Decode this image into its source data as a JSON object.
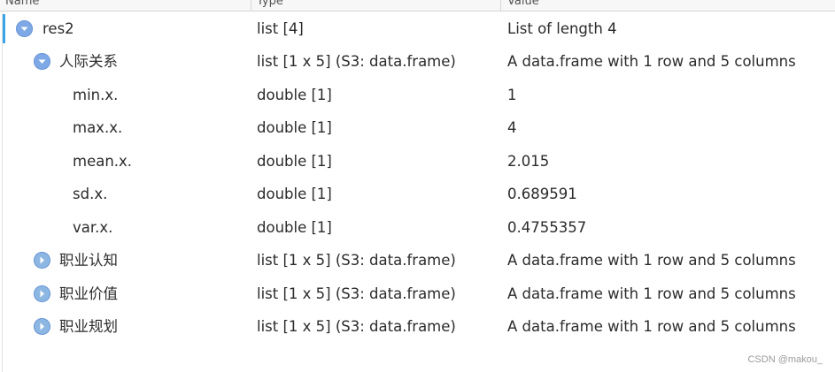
{
  "header": {
    "name": "Name",
    "type": "Type",
    "value": "Value"
  },
  "rows": [
    {
      "name": "res2",
      "type": "list [4]",
      "value": "List of length 4",
      "state": "expanded"
    },
    {
      "name": "人际关系",
      "type": "list [1 x 5] (S3: data.frame)",
      "value": "A data.frame with 1 row and 5 columns",
      "state": "expanded"
    },
    {
      "name": "min.x.",
      "type": "double [1]",
      "value": "1"
    },
    {
      "name": "max.x.",
      "type": "double [1]",
      "value": "4"
    },
    {
      "name": "mean.x.",
      "type": "double [1]",
      "value": "2.015"
    },
    {
      "name": "sd.x.",
      "type": "double [1]",
      "value": "0.689591"
    },
    {
      "name": "var.x.",
      "type": "double [1]",
      "value": "0.4755357"
    },
    {
      "name": "职业认知",
      "type": "list [1 x 5] (S3: data.frame)",
      "value": "A data.frame with 1 row and 5 columns",
      "state": "collapsed"
    },
    {
      "name": "职业价值",
      "type": "list [1 x 5] (S3: data.frame)",
      "value": "A data.frame with 1 row and 5 columns",
      "state": "collapsed"
    },
    {
      "name": "职业规划",
      "type": "list [1 x 5] (S3: data.frame)",
      "value": "A data.frame with 1 row and 5 columns",
      "state": "collapsed"
    }
  ],
  "watermark": "CSDN @makou_",
  "colors": {
    "selection_bar": "#3aa6e8",
    "toggle_fill": "#7fa9e6"
  },
  "icons": {
    "expanded": "chevron-down-icon",
    "collapsed": "chevron-right-icon"
  }
}
